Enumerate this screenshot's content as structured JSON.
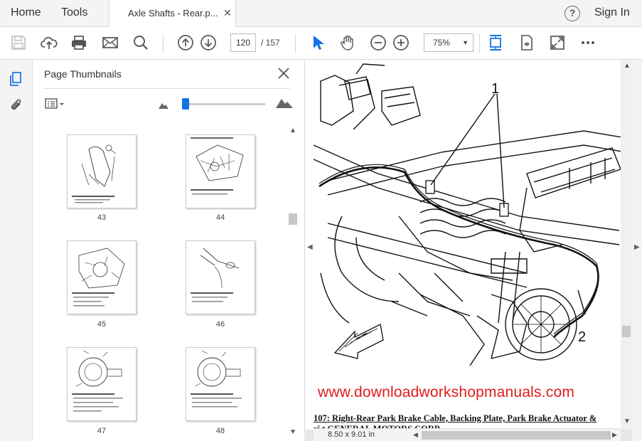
{
  "menubar": {
    "home_label": "Home",
    "tools_label": "Tools",
    "tab_title": "Axle Shafts - Rear.p...",
    "tab_close": "✕",
    "help": "?",
    "signin_label": "Sign In"
  },
  "toolbar": {
    "current_page": "120",
    "page_of": "/  157",
    "zoom": "75%",
    "zoom_caret": "▼",
    "icons": [
      "save-icon",
      "upload-icon",
      "print-icon",
      "email-icon",
      "search-icon",
      "previous-page-icon",
      "next-page-icon",
      "select-cursor-icon",
      "hand-icon",
      "zoom-out-icon",
      "zoom-in-icon",
      "scroll-mode-icon",
      "page-fit-icon",
      "fullscreen-icon",
      "more-icon"
    ]
  },
  "panel": {
    "title": "Page Thumbnails",
    "close": "✕",
    "thumbnails": [
      {
        "page": "43"
      },
      {
        "page": "44"
      },
      {
        "page": "45"
      },
      {
        "page": "46"
      },
      {
        "page": "47"
      },
      {
        "page": "48"
      }
    ]
  },
  "document": {
    "callout_1": "1",
    "callout_2": "2",
    "watermark": "www.downloadworkshopmanuals.com",
    "caption_line1": "107: Right-Rear Park Brake Cable, Backing Plate, Park Brake Actuator &",
    "caption_line2": "        ri  t GENERAL MOTORS CORP",
    "page_size": "8.50 x 9.01 in"
  },
  "colors": {
    "accent": "#1473e6",
    "watermark": "#e21b1b"
  }
}
